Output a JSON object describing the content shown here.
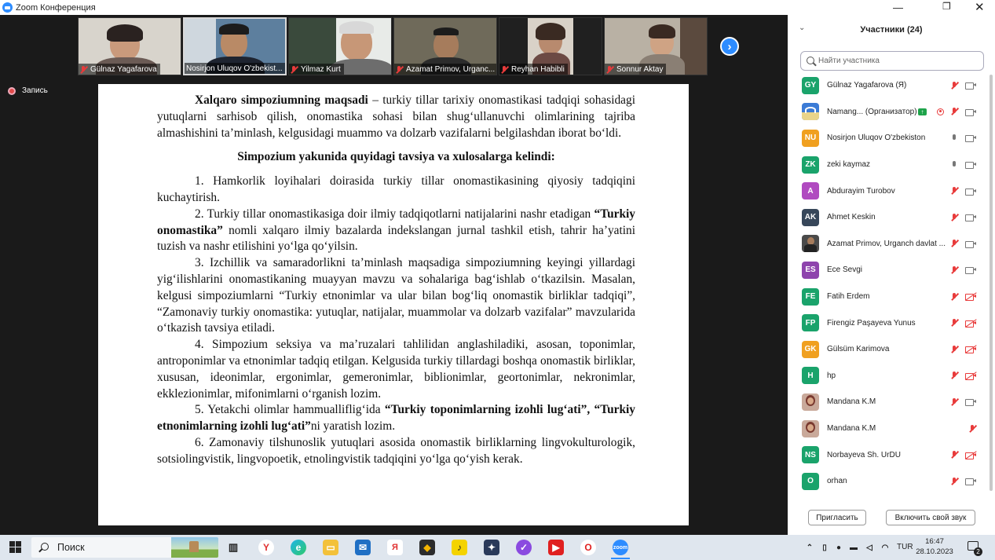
{
  "window": {
    "title": "Zoom Конференция"
  },
  "video_strip": {
    "tiles": [
      {
        "name": "Gülnaz Yagafarova"
      },
      {
        "name": "Nosirjon Uluqov O'zbekist..."
      },
      {
        "name": "Yilmaz Kurt"
      },
      {
        "name": "Azamat Primov, Urganc..."
      },
      {
        "name": "Reyhan Habibli"
      },
      {
        "name": "Sonnur Aktay"
      }
    ]
  },
  "recording": {
    "label": "Запись"
  },
  "document": {
    "intro_bold": "Xalqaro simpoziumning maqsadi",
    "intro_rest": " – turkiy tillar tarixiy onomastikasi tadqiqi sohasidagi yutuqlarni sarhisob qilish, onomastika sohasi bilan shug‘ullanuvchi olimlarining tajriba almashishini ta’minlash, kelgusidagi muammo va dolzarb vazifalarni belgilashdan iborat bo‘ldi.",
    "heading": "Simpozium yakunida quyidagi tavsiya va xulosalarga kelindi:",
    "p1": "1. Hamkorlik loyihalari doirasida turkiy tillar onomastikasining qiyosiy tadqiqini kuchaytirish.",
    "p2a": "2. Turkiy tillar onomastikasiga doir ilmiy tadqiqotlarni natijalarini nashr etadigan ",
    "p2b": "“Turkiy onomastika”",
    "p2c": " nomli xalqaro ilmiy bazalarda indekslangan jurnal tashkil etish, tahrir ha’yatini tuzish va nashr etilishini yo‘lga qo‘yilsin.",
    "p3": "3. Izchillik va samaradorlikni ta’minlash maqsadiga simpoziumning keyingi yillardagi yig‘ilishlarini onomastikaning muayyan mavzu va sohalariga bag‘ishlab o‘tkazilsin. Masalan, kelgusi simpoziumlarni “Turkiy etnonimlar va ular bilan bog‘liq onomastik birliklar tadqiqi”, “Zamonaviy turkiy onomastika: yutuqlar, natijalar, muammolar va dolzarb vazifalar” mavzularida o‘tkazish tavsiya etiladi.",
    "p4": "4. Simpozium seksiya va ma’ruzalari tahlilidan anglashiladiki, asosan, toponimlar, antroponimlar va etnonimlar tadqiq etilgan. Kelgusida turkiy tillardagi boshqa onomastik birliklar, xususan, ideonimlar, ergonimlar, gemeronimlar, biblionimlar, geortonimlar, nekronimlar, ekklezionimlar, mifonimlarni o‘rganish lozim.",
    "p5a": "5. Yetakchi olimlar hammualliflig‘ida ",
    "p5b": "“Turkiy toponimlarning izohli lug‘ati”, “Turkiy etnonimlarning izohli lug‘ati”",
    "p5c": "ni yaratish lozim.",
    "p6": "6. Zamonaviy tilshunoslik yutuqlari asosida onomastik birliklarning lingvokulturologik, sotsiolingvistik, lingvopoetik, etnolingvistik tadqiqini yo‘lga qo‘yish kerak."
  },
  "participants_panel": {
    "title": "Участники (24)",
    "search_placeholder": "Найти участника",
    "invite_label": "Пригласить",
    "unmute_label": "Включить свой звук",
    "participants": [
      {
        "initials": "GY",
        "name": "Gülnaz Yagafarova (Я)",
        "color": "#1aa36b"
      },
      {
        "initials": "",
        "name": "Namang...  (Организатор)",
        "color": "#3b7bd6"
      },
      {
        "initials": "NU",
        "name": "Nosirjon Uluqov O'zbekiston",
        "color": "#f0a020"
      },
      {
        "initials": "ZK",
        "name": "zeki kaymaz",
        "color": "#1aa36b"
      },
      {
        "initials": "A",
        "name": "Abdurayim Turobov",
        "color": "#b04ac0"
      },
      {
        "initials": "AK",
        "name": "Ahmet Keskin",
        "color": "#37475a"
      },
      {
        "initials": "",
        "name": "Azamat Primov, Urganch davlat ...",
        "color": "#4a4a4a"
      },
      {
        "initials": "ES",
        "name": "Ece Sevgi",
        "color": "#8e44ad"
      },
      {
        "initials": "FE",
        "name": "Fatih Erdem",
        "color": "#1aa36b"
      },
      {
        "initials": "FP",
        "name": "Firengiz Paşayeva Yunus",
        "color": "#1aa36b"
      },
      {
        "initials": "GK",
        "name": "Gülsüm Karimova",
        "color": "#f0a020"
      },
      {
        "initials": "H",
        "name": "hp",
        "color": "#1aa36b"
      },
      {
        "initials": "",
        "name": "Mandana K.M",
        "color": "#a05a50"
      },
      {
        "initials": "",
        "name": "Mandana K.M",
        "color": "#a05a50"
      },
      {
        "initials": "NS",
        "name": "Norbayeva Sh. UrDU",
        "color": "#1aa36b"
      },
      {
        "initials": "O",
        "name": "orhan",
        "color": "#1aa36b"
      }
    ]
  },
  "taskbar": {
    "search_label": "Поиск",
    "language": "TUR",
    "time": "16:47",
    "date": "28.10.2023",
    "notification_count": "2"
  }
}
